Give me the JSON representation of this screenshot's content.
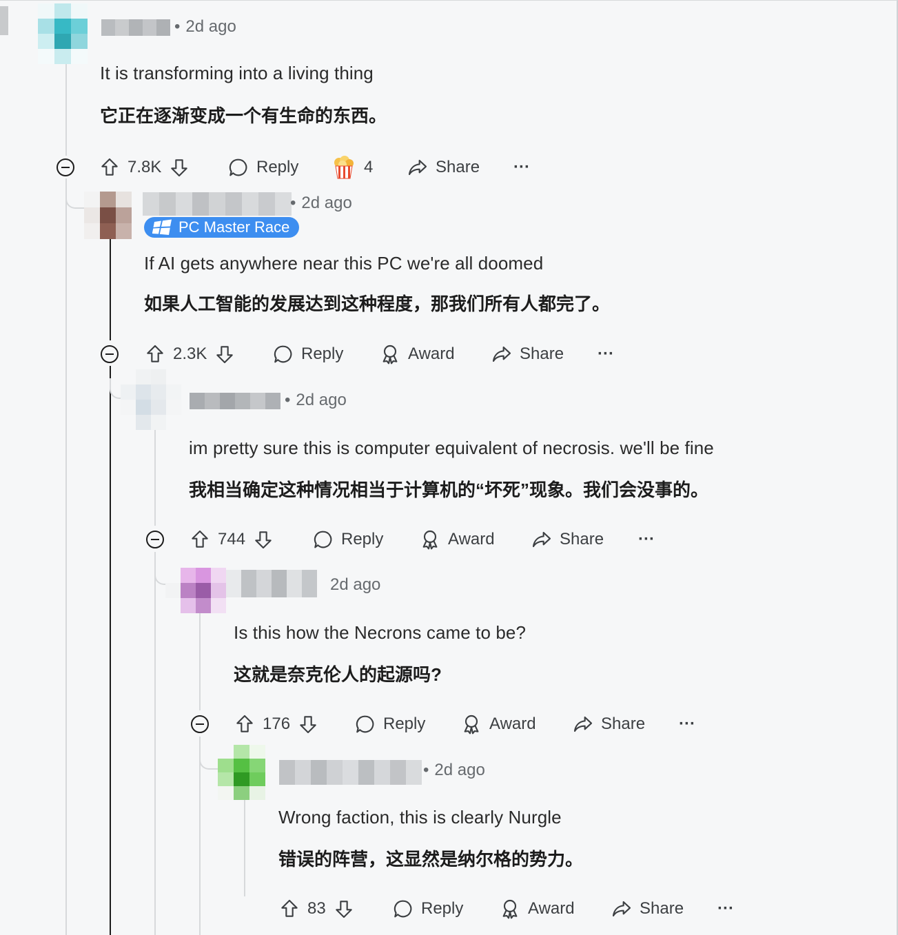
{
  "colors": {
    "background": "#f6f7f8",
    "flair_bg": "#3d8ef0",
    "text": "#1c1c1c",
    "meta": "#666a6e"
  },
  "comments": [
    {
      "time": "2d ago",
      "text_en": "It is transforming into a living thing",
      "text_zh": "它正在逐渐变成一个有生命的东西。",
      "votes": "7.8K",
      "reply_label": "Reply",
      "award_count": "4",
      "share_label": "Share",
      "more_label": "···"
    },
    {
      "time": "2d ago",
      "flair": "PC Master Race",
      "text_en": "If AI gets anywhere near this PC we're all doomed",
      "text_zh": "如果人工智能的发展达到这种程度，那我们所有人都完了。",
      "votes": "2.3K",
      "reply_label": "Reply",
      "award_label": "Award",
      "share_label": "Share",
      "more_label": "···"
    },
    {
      "time": "2d ago",
      "text_en": "im pretty sure this is computer equivalent of necrosis. we'll be fine",
      "text_zh": "我相当确定这种情况相当于计算机的“坏死”现象。我们会没事的。",
      "votes": "744",
      "reply_label": "Reply",
      "award_label": "Award",
      "share_label": "Share",
      "more_label": "···"
    },
    {
      "time": "2d ago",
      "text_en": "Is this how the Necrons came to be?",
      "text_zh": "这就是奈克伦人的起源吗?",
      "votes": "176",
      "reply_label": "Reply",
      "award_label": "Award",
      "share_label": "Share",
      "more_label": "···"
    },
    {
      "time": "2d ago",
      "text_en": "Wrong faction, this is clearly Nurgle",
      "text_zh": "错误的阵营，这显然是纳尔格的势力。",
      "votes": "83",
      "reply_label": "Reply",
      "award_label": "Award",
      "share_label": "Share",
      "more_label": "···"
    }
  ]
}
